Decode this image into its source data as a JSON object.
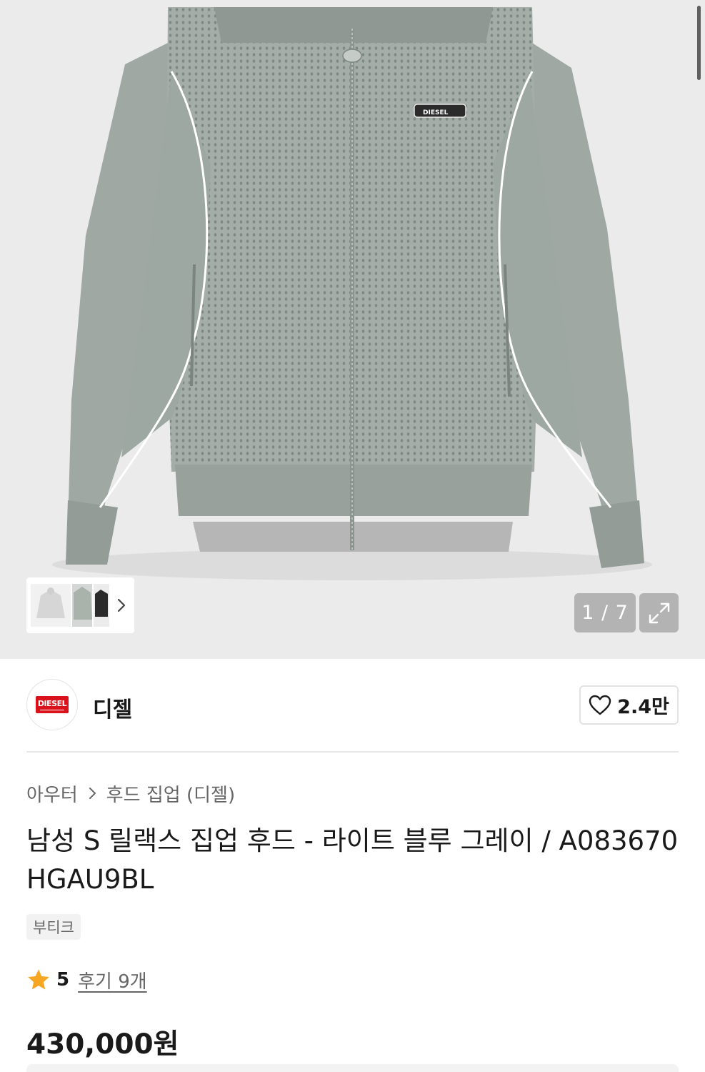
{
  "gallery": {
    "counter": "1 / 7",
    "expand_icon": "expand-icon",
    "thumbnail_next_icon": "chevron-right-icon",
    "brand_print": "DIESEL"
  },
  "brand": {
    "logo_text": "DIESEL",
    "name": "디젤",
    "like_count": "2.4만",
    "like_icon": "heart-outline-icon",
    "logo_color": "#d9121b"
  },
  "breadcrumb": {
    "category": "아우터",
    "subcategory": "후드 집업 (디젤)",
    "separator_icon": "chevron-right-icon"
  },
  "product": {
    "title": "남성 S 릴랙스 집업 후드 - 라이트 블루 그레이 / A083670HGAU9BL",
    "tag": "부티크",
    "rating": "5",
    "reviews_label": "후기 9개",
    "price": "430,000원",
    "star_color": "#f6a623"
  }
}
